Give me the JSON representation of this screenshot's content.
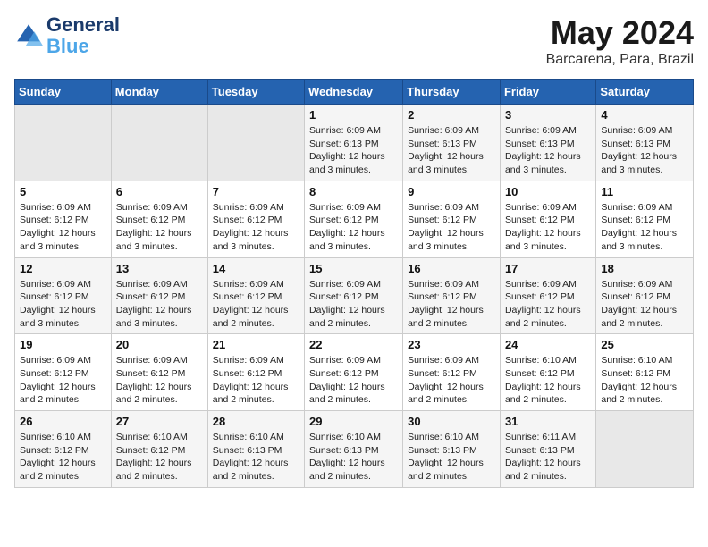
{
  "header": {
    "logo_general": "General",
    "logo_blue": "Blue",
    "month_year": "May 2024",
    "location": "Barcarena, Para, Brazil"
  },
  "weekdays": [
    "Sunday",
    "Monday",
    "Tuesday",
    "Wednesday",
    "Thursday",
    "Friday",
    "Saturday"
  ],
  "weeks": [
    [
      {
        "day": "",
        "info": ""
      },
      {
        "day": "",
        "info": ""
      },
      {
        "day": "",
        "info": ""
      },
      {
        "day": "1",
        "info": "Sunrise: 6:09 AM\nSunset: 6:13 PM\nDaylight: 12 hours\nand 3 minutes."
      },
      {
        "day": "2",
        "info": "Sunrise: 6:09 AM\nSunset: 6:13 PM\nDaylight: 12 hours\nand 3 minutes."
      },
      {
        "day": "3",
        "info": "Sunrise: 6:09 AM\nSunset: 6:13 PM\nDaylight: 12 hours\nand 3 minutes."
      },
      {
        "day": "4",
        "info": "Sunrise: 6:09 AM\nSunset: 6:13 PM\nDaylight: 12 hours\nand 3 minutes."
      }
    ],
    [
      {
        "day": "5",
        "info": "Sunrise: 6:09 AM\nSunset: 6:12 PM\nDaylight: 12 hours\nand 3 minutes."
      },
      {
        "day": "6",
        "info": "Sunrise: 6:09 AM\nSunset: 6:12 PM\nDaylight: 12 hours\nand 3 minutes."
      },
      {
        "day": "7",
        "info": "Sunrise: 6:09 AM\nSunset: 6:12 PM\nDaylight: 12 hours\nand 3 minutes."
      },
      {
        "day": "8",
        "info": "Sunrise: 6:09 AM\nSunset: 6:12 PM\nDaylight: 12 hours\nand 3 minutes."
      },
      {
        "day": "9",
        "info": "Sunrise: 6:09 AM\nSunset: 6:12 PM\nDaylight: 12 hours\nand 3 minutes."
      },
      {
        "day": "10",
        "info": "Sunrise: 6:09 AM\nSunset: 6:12 PM\nDaylight: 12 hours\nand 3 minutes."
      },
      {
        "day": "11",
        "info": "Sunrise: 6:09 AM\nSunset: 6:12 PM\nDaylight: 12 hours\nand 3 minutes."
      }
    ],
    [
      {
        "day": "12",
        "info": "Sunrise: 6:09 AM\nSunset: 6:12 PM\nDaylight: 12 hours\nand 3 minutes."
      },
      {
        "day": "13",
        "info": "Sunrise: 6:09 AM\nSunset: 6:12 PM\nDaylight: 12 hours\nand 3 minutes."
      },
      {
        "day": "14",
        "info": "Sunrise: 6:09 AM\nSunset: 6:12 PM\nDaylight: 12 hours\nand 2 minutes."
      },
      {
        "day": "15",
        "info": "Sunrise: 6:09 AM\nSunset: 6:12 PM\nDaylight: 12 hours\nand 2 minutes."
      },
      {
        "day": "16",
        "info": "Sunrise: 6:09 AM\nSunset: 6:12 PM\nDaylight: 12 hours\nand 2 minutes."
      },
      {
        "day": "17",
        "info": "Sunrise: 6:09 AM\nSunset: 6:12 PM\nDaylight: 12 hours\nand 2 minutes."
      },
      {
        "day": "18",
        "info": "Sunrise: 6:09 AM\nSunset: 6:12 PM\nDaylight: 12 hours\nand 2 minutes."
      }
    ],
    [
      {
        "day": "19",
        "info": "Sunrise: 6:09 AM\nSunset: 6:12 PM\nDaylight: 12 hours\nand 2 minutes."
      },
      {
        "day": "20",
        "info": "Sunrise: 6:09 AM\nSunset: 6:12 PM\nDaylight: 12 hours\nand 2 minutes."
      },
      {
        "day": "21",
        "info": "Sunrise: 6:09 AM\nSunset: 6:12 PM\nDaylight: 12 hours\nand 2 minutes."
      },
      {
        "day": "22",
        "info": "Sunrise: 6:09 AM\nSunset: 6:12 PM\nDaylight: 12 hours\nand 2 minutes."
      },
      {
        "day": "23",
        "info": "Sunrise: 6:09 AM\nSunset: 6:12 PM\nDaylight: 12 hours\nand 2 minutes."
      },
      {
        "day": "24",
        "info": "Sunrise: 6:10 AM\nSunset: 6:12 PM\nDaylight: 12 hours\nand 2 minutes."
      },
      {
        "day": "25",
        "info": "Sunrise: 6:10 AM\nSunset: 6:12 PM\nDaylight: 12 hours\nand 2 minutes."
      }
    ],
    [
      {
        "day": "26",
        "info": "Sunrise: 6:10 AM\nSunset: 6:12 PM\nDaylight: 12 hours\nand 2 minutes."
      },
      {
        "day": "27",
        "info": "Sunrise: 6:10 AM\nSunset: 6:12 PM\nDaylight: 12 hours\nand 2 minutes."
      },
      {
        "day": "28",
        "info": "Sunrise: 6:10 AM\nSunset: 6:13 PM\nDaylight: 12 hours\nand 2 minutes."
      },
      {
        "day": "29",
        "info": "Sunrise: 6:10 AM\nSunset: 6:13 PM\nDaylight: 12 hours\nand 2 minutes."
      },
      {
        "day": "30",
        "info": "Sunrise: 6:10 AM\nSunset: 6:13 PM\nDaylight: 12 hours\nand 2 minutes."
      },
      {
        "day": "31",
        "info": "Sunrise: 6:11 AM\nSunset: 6:13 PM\nDaylight: 12 hours\nand 2 minutes."
      },
      {
        "day": "",
        "info": ""
      }
    ]
  ]
}
